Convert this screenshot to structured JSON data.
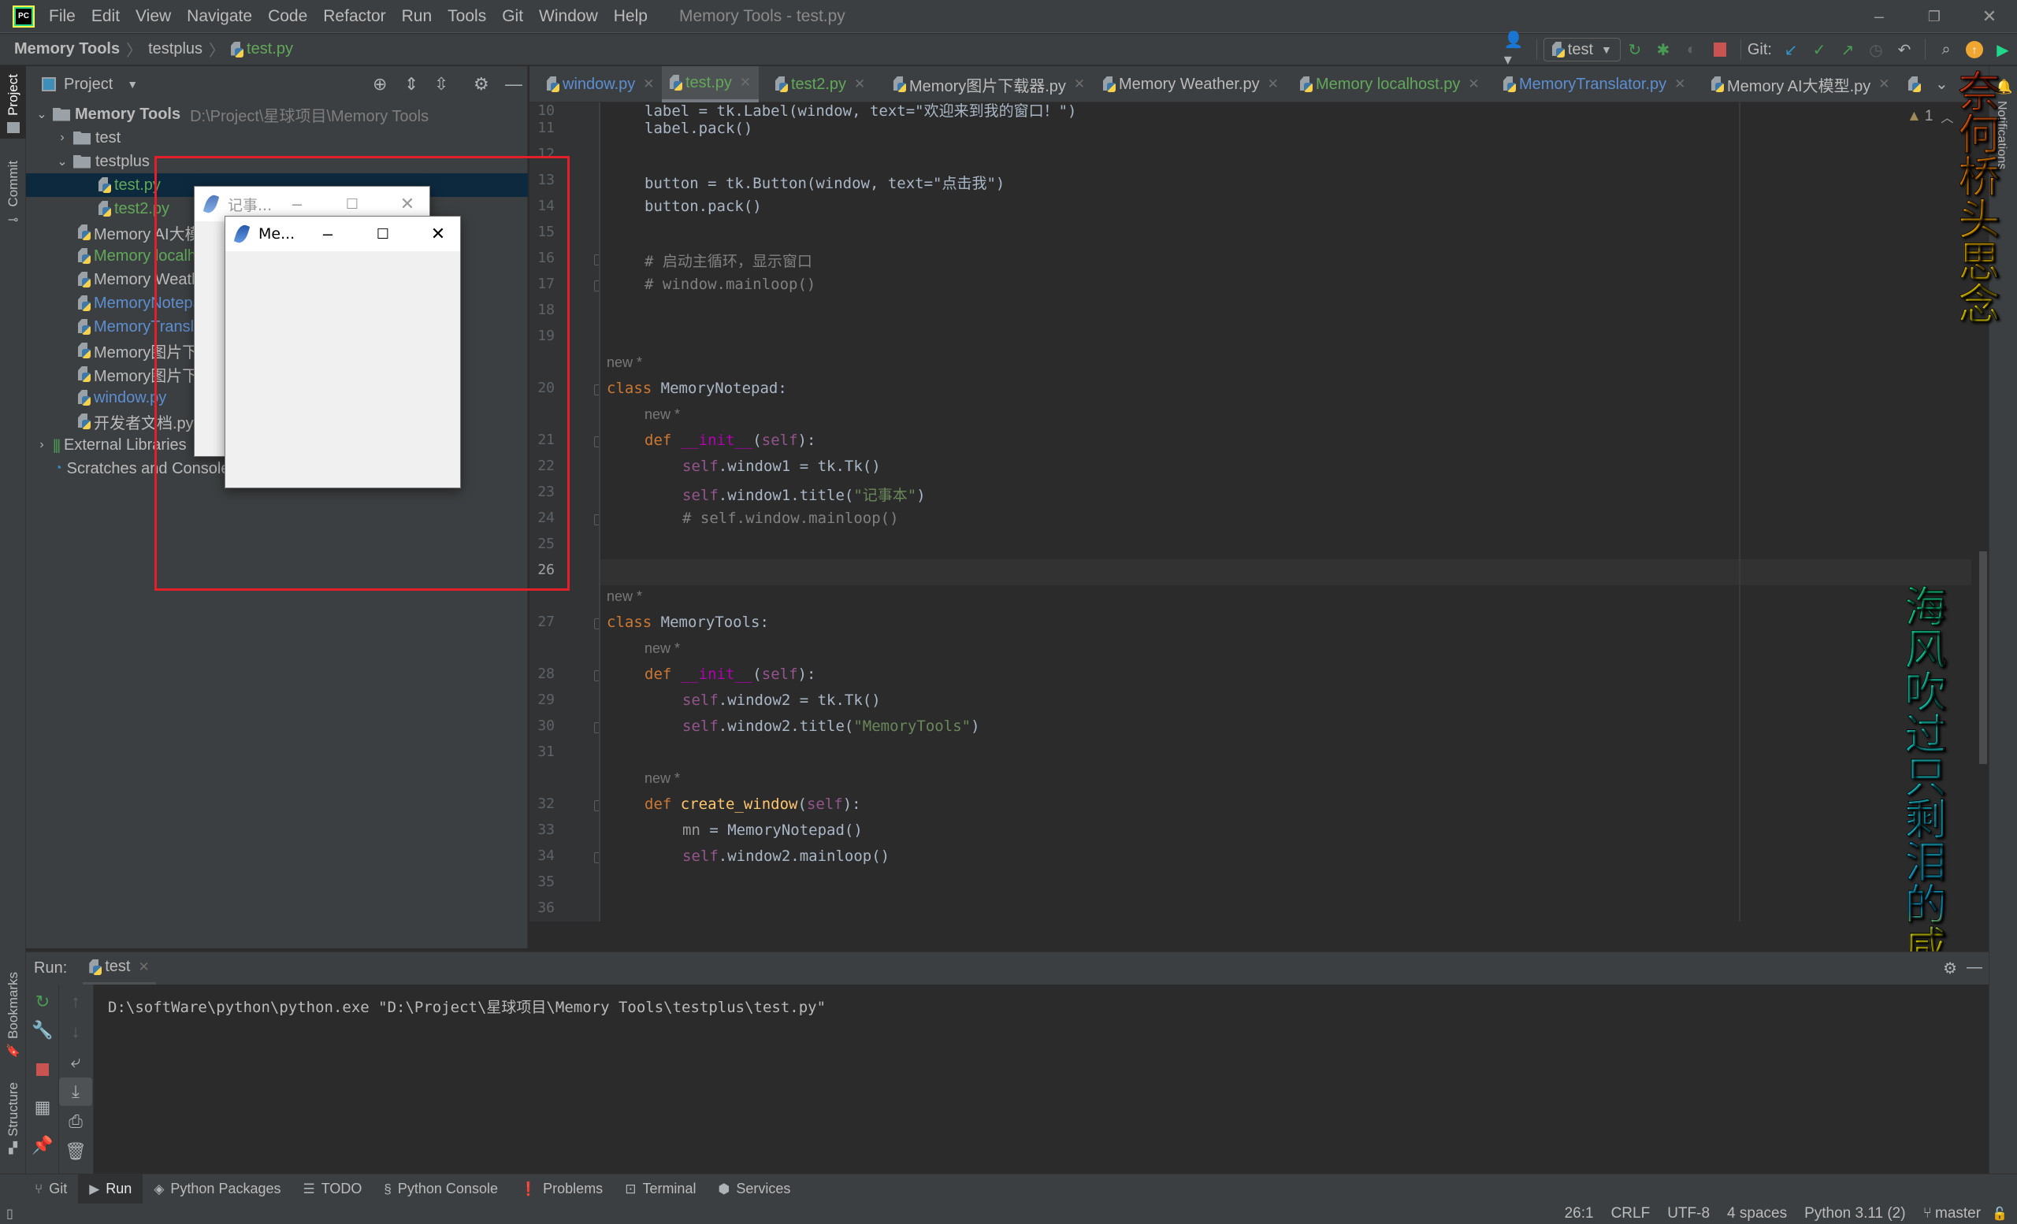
{
  "titlebar": {
    "menu": [
      "File",
      "Edit",
      "View",
      "Navigate",
      "Code",
      "Refactor",
      "Run",
      "Tools",
      "Git",
      "Window",
      "Help"
    ],
    "window_title": "Memory Tools - test.py",
    "controls": {
      "minimize": "–",
      "restore": "❐",
      "close": "✕"
    }
  },
  "navbar": {
    "breadcrumb": [
      "Memory Tools",
      "testplus",
      "test.py"
    ],
    "run_config": "test",
    "git_label": "Git:"
  },
  "left_strip": {
    "tabs": [
      "Project",
      "Commit",
      "Bookmarks",
      "Structure"
    ]
  },
  "project_panel": {
    "title": "Project",
    "tree": [
      {
        "label": "Memory Tools",
        "hint": "D:\\Project\\星球项目\\Memory Tools",
        "type": "folder",
        "expanded": true,
        "level": 0
      },
      {
        "label": "test",
        "type": "folder",
        "expanded": false,
        "level": 1
      },
      {
        "label": "testplus",
        "type": "folder",
        "expanded": true,
        "level": 1
      },
      {
        "label": "test.py",
        "type": "file",
        "level": 2,
        "selected": true,
        "status": "added"
      },
      {
        "label": "test2.py",
        "type": "file",
        "level": 2,
        "status": "added"
      },
      {
        "label": "Memory AI大模型.py",
        "type": "file",
        "level": 1,
        "status": "normal"
      },
      {
        "label": "Memory localhost.py",
        "type": "file",
        "level": 1,
        "status": "added"
      },
      {
        "label": "Memory Weather.py",
        "type": "file",
        "level": 1,
        "status": "normal"
      },
      {
        "label": "MemoryNotepad.py",
        "type": "file",
        "level": 1,
        "status": "modified"
      },
      {
        "label": "MemoryTranslator.py",
        "type": "file",
        "level": 1,
        "status": "modified"
      },
      {
        "label": "Memory图片下载器.py",
        "type": "file",
        "level": 1,
        "status": "normal"
      },
      {
        "label": "Memory图片下载器2.py",
        "type": "file",
        "level": 1,
        "status": "normal"
      },
      {
        "label": "window.py",
        "type": "file",
        "level": 1,
        "status": "modified"
      },
      {
        "label": "开发者文档.py",
        "type": "file",
        "level": 1,
        "status": "normal"
      },
      {
        "label": "External Libraries",
        "type": "library",
        "expanded": false,
        "level": 0
      },
      {
        "label": "Scratches and Consoles",
        "type": "scratch",
        "level": 0
      }
    ]
  },
  "tk_windows": [
    {
      "title": "记事...",
      "active": false
    },
    {
      "title": "Me...",
      "active": true
    }
  ],
  "editor_tabs": [
    {
      "label": "window.py",
      "status": "modified",
      "active": false
    },
    {
      "label": "test.py",
      "status": "added",
      "active": true
    },
    {
      "label": "test2.py",
      "status": "added",
      "active": false
    },
    {
      "label": "Memory图片下载器.py",
      "status": "normal",
      "active": false
    },
    {
      "label": "Memory Weather.py",
      "status": "normal",
      "active": false
    },
    {
      "label": "Memory localhost.py",
      "status": "added",
      "active": false
    },
    {
      "label": "MemoryTranslator.py",
      "status": "modified",
      "active": false
    },
    {
      "label": "Memory AI大模型.py",
      "status": "normal",
      "active": false
    }
  ],
  "editor": {
    "inspection_count": "1",
    "inlay_hint": "new *",
    "lines": [
      {
        "n": "10",
        "code": "label = tk.Label(window, text=\"欢迎来到我的窗口！\")"
      },
      {
        "n": "11",
        "code": "label.pack()"
      },
      {
        "n": "12",
        "code": ""
      },
      {
        "n": "13",
        "code": "button = tk.Button(window, text=\"点击我\")"
      },
      {
        "n": "14",
        "code": "button.pack()"
      },
      {
        "n": "15",
        "code": ""
      },
      {
        "n": "16",
        "code": "# 启动主循环，显示窗口"
      },
      {
        "n": "17",
        "code": "# window.mainloop()"
      },
      {
        "n": "18",
        "code": ""
      },
      {
        "n": "19",
        "code": ""
      },
      {
        "n": "20",
        "code": "class MemoryNotepad:"
      },
      {
        "n": "21",
        "code": "def __init__(self):"
      },
      {
        "n": "22",
        "code": "self.window1 = tk.Tk()"
      },
      {
        "n": "23",
        "code": "self.window1.title(\"记事本\")"
      },
      {
        "n": "24",
        "code": "# self.window.mainloop()"
      },
      {
        "n": "25",
        "code": ""
      },
      {
        "n": "26",
        "code": ""
      },
      {
        "n": "27",
        "code": "class MemoryTools:"
      },
      {
        "n": "28",
        "code": "def __init__(self):"
      },
      {
        "n": "29",
        "code": "self.window2 = tk.Tk()"
      },
      {
        "n": "30",
        "code": "self.window2.title(\"MemoryTools\")"
      },
      {
        "n": "31",
        "code": ""
      },
      {
        "n": "32",
        "code": "def create_window(self):"
      },
      {
        "n": "33",
        "code": "mn = MemoryNotepad()"
      },
      {
        "n": "34",
        "code": "self.window2.mainloop()"
      },
      {
        "n": "35",
        "code": ""
      },
      {
        "n": "36",
        "code": ""
      }
    ]
  },
  "overlay_lyrics": {
    "top": "奈何桥头思念",
    "bottom": "海风吹过只剩泪的咸"
  },
  "right_strip": {
    "notifications_label": "Notifications"
  },
  "run_panel": {
    "label": "Run:",
    "tab": "test",
    "console_output": "D:\\softWare\\python\\python.exe \"D:\\Project\\星球项目\\Memory Tools\\testplus\\test.py\""
  },
  "bottom_tabs": [
    {
      "label": "Git",
      "icon": "git-branch-icon"
    },
    {
      "label": "Run",
      "icon": "run-icon",
      "active": true
    },
    {
      "label": "Python Packages",
      "icon": "packages-icon"
    },
    {
      "label": "TODO",
      "icon": "todo-list-icon"
    },
    {
      "label": "Python Console",
      "icon": "python-console-icon"
    },
    {
      "label": "Problems",
      "icon": "problems-icon"
    },
    {
      "label": "Terminal",
      "icon": "terminal-icon"
    },
    {
      "label": "Services",
      "icon": "services-icon"
    }
  ],
  "statusbar": {
    "position": "26:1",
    "line_separator": "CRLF",
    "encoding": "UTF-8",
    "indent": "4 spaces",
    "interpreter": "Python 3.11 (2)",
    "branch": "master"
  },
  "colors": {
    "added": "#62a85a",
    "modified": "#6897bb",
    "keyword": "#cc7832",
    "string": "#6a8759",
    "self": "#94558d",
    "highlight_box": "#e3202a"
  }
}
